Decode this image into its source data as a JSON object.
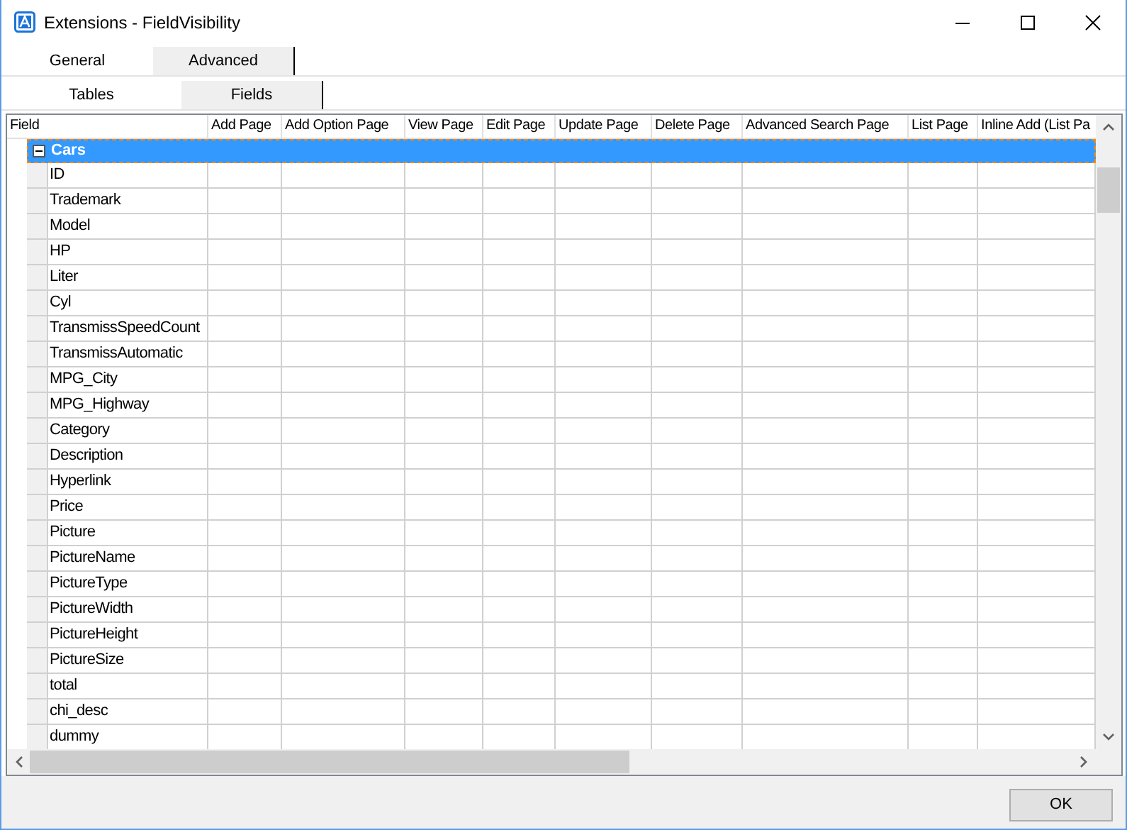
{
  "window": {
    "title": "Extensions - FieldVisibility"
  },
  "tabs": [
    {
      "label": "General",
      "selected": false
    },
    {
      "label": "Advanced",
      "selected": true
    }
  ],
  "subtabs": [
    {
      "label": "Tables",
      "selected": false
    },
    {
      "label": "Fields",
      "selected": true
    }
  ],
  "grid": {
    "columns": [
      "Field",
      "Add Page",
      "Add Option Page",
      "View Page",
      "Edit Page",
      "Update Page",
      "Delete Page",
      "Advanced Search Page",
      "List Page",
      "Inline Add (List Pa"
    ],
    "group": {
      "label": "Cars",
      "expanded": true,
      "selected": true
    },
    "rows": [
      "ID",
      "Trademark",
      "Model",
      "HP",
      "Liter",
      "Cyl",
      "TransmissSpeedCount",
      "TransmissAutomatic",
      "MPG_City",
      "MPG_Highway",
      "Category",
      "Description",
      "Hyperlink",
      "Price",
      "Picture",
      "PictureName",
      "PictureType",
      "PictureWidth",
      "PictureHeight",
      "PictureSize",
      "total",
      "chi_desc",
      "dummy"
    ]
  },
  "buttons": [
    "OK"
  ]
}
